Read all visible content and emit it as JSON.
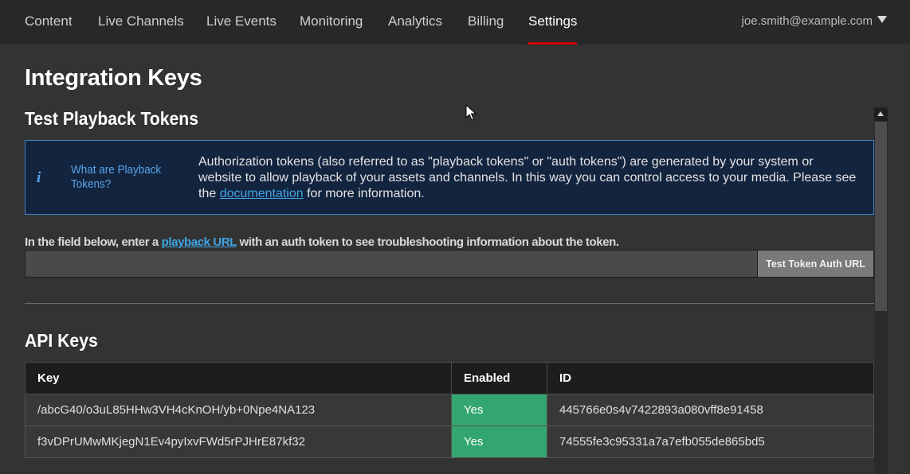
{
  "nav": {
    "items": [
      {
        "label": "Content"
      },
      {
        "label": "Live Channels"
      },
      {
        "label": "Live Events"
      },
      {
        "label": "Monitoring"
      },
      {
        "label": "Analytics"
      },
      {
        "label": "Billing"
      },
      {
        "label": "Settings",
        "active": true
      }
    ],
    "user_email": "joe.smith@example.com",
    "accent_color": "#cd040b"
  },
  "page": {
    "title": "Integration Keys"
  },
  "playback": {
    "section_title": "Test Playback Tokens",
    "info_icon": "info-icon",
    "info_question": "What are Playback Tokens?",
    "info_text_before_link": "Authorization tokens (also referred to as \"playback tokens\" or \"auth tokens\") are generated by your system or website to allow playback of your assets and channels. In this way you can control access to your media. Please see the ",
    "info_link": "documentation",
    "info_text_after_link": " for more information.",
    "instruction_before_link": "In the field below, enter a ",
    "instruction_link": "playback URL",
    "instruction_after_link": " with an auth token to see troubleshooting information about the token.",
    "input_value": "",
    "input_placeholder": "",
    "button_label": "Test Token Auth URL"
  },
  "api_keys": {
    "section_title": "API Keys",
    "columns": [
      "Key",
      "Enabled",
      "ID"
    ],
    "rows": [
      {
        "key": "/abcG40/o3uL85HHw3VH4cKnOH/yb+0Npe4NA123",
        "enabled": "Yes",
        "id": "445766e0s4v7422893a080vff8e91458"
      },
      {
        "key": "f3vDPrUMwMKjegN1Ev4pyIxvFWd5rPJHrE87kf32",
        "enabled": "Yes",
        "id": "74555fe3c95331a7a7efb055de865bd5"
      }
    ],
    "enabled_color": "#33a66f"
  }
}
